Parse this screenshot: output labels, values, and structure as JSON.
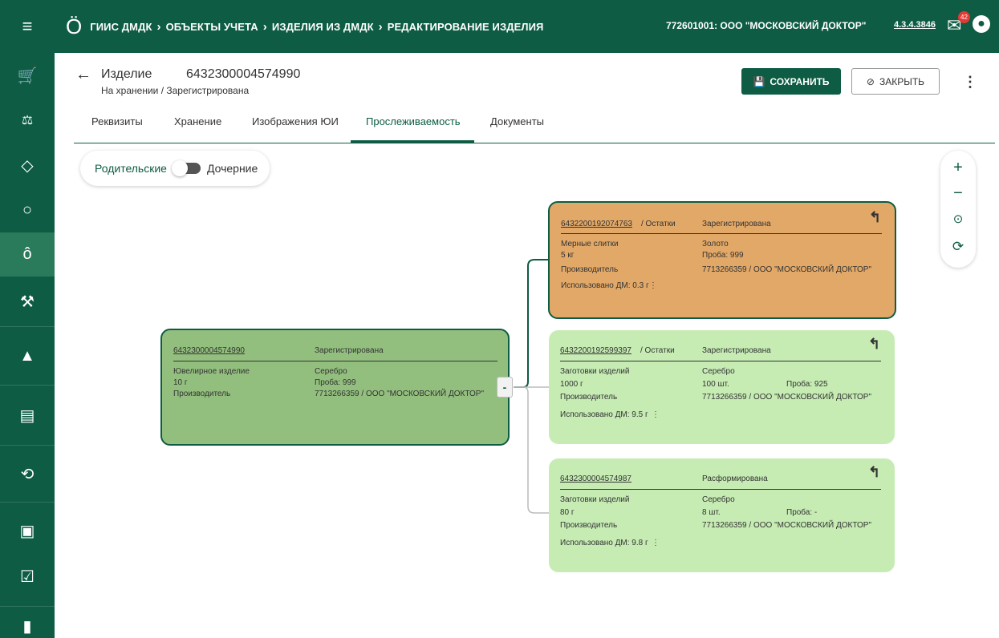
{
  "header": {
    "breadcrumbs": [
      "ГИИС ДМДК",
      "ОБЪЕКТЫ УЧЕТА",
      "ИЗДЕЛИЯ ИЗ ДМДК",
      "РЕДАКТИРОВАНИЕ ИЗДЕЛИЯ"
    ],
    "org": "772601001: ООО \"МОСКОВСКИЙ ДОКТОР\"",
    "version": "4.3.4.3846",
    "mail_badge": "42"
  },
  "page": {
    "title": "Изделие",
    "id": "6432300004574990",
    "subtitle": "На хранении / Зарегистрирована",
    "save_label": "СОХРАНИТЬ",
    "close_label": "ЗАКРЫТЬ"
  },
  "tabs": [
    {
      "label": "Реквизиты"
    },
    {
      "label": "Хранение"
    },
    {
      "label": "Изображения ЮИ"
    },
    {
      "label": "Прослеживаемость"
    },
    {
      "label": "Документы"
    }
  ],
  "toggle": {
    "left": "Родительские",
    "right": "Дочерние"
  },
  "zoom": {
    "plus": "+",
    "minus": "−",
    "more": "⋮"
  },
  "root": {
    "id": "6432300004574990",
    "status": "Зарегистрирована",
    "type": "Ювелирное изделие",
    "weight": "10 г",
    "metal": "Серебро",
    "probe": "Проба: 999",
    "maker_label": "Производитель",
    "maker": "7713266359 / ООО \"МОСКОВСКИЙ ДОКТОР\""
  },
  "children": [
    {
      "id": "6432200192074763",
      "suffix": "/ Остатки",
      "status": "Зарегистрирована",
      "type": "Мерные слитки",
      "weight": "5 кг",
      "metal": "Золото",
      "probe": "Проба: 999",
      "qty": "",
      "maker_label": "Производитель",
      "maker": "7713266359 / ООО \"МОСКОВСКИЙ ДОКТОР\"",
      "used": "Использовано ДМ: 0.3 г"
    },
    {
      "id": "6432200192599397",
      "suffix": "/ Остатки",
      "status": "Зарегистрирована",
      "type": "Заготовки изделий",
      "weight": "1000 г",
      "metal": "Серебро",
      "qty": "100 шт.",
      "probe": "Проба: 925",
      "maker_label": "Производитель",
      "maker": "7713266359 / ООО \"МОСКОВСКИЙ ДОКТОР\"",
      "used": "Использовано ДМ: 9.5 г"
    },
    {
      "id": "6432300004574987",
      "suffix": "",
      "status": "Расформирована",
      "type": "Заготовки изделий",
      "weight": "80 г",
      "metal": "Серебро",
      "qty": "8 шт.",
      "probe": "Проба: -",
      "maker_label": "Производитель",
      "maker": "7713266359 / ООО \"МОСКОВСКИЙ ДОКТОР\"",
      "used": "Использовано ДМ: 9.8 г"
    }
  ],
  "collapse_label": "-"
}
